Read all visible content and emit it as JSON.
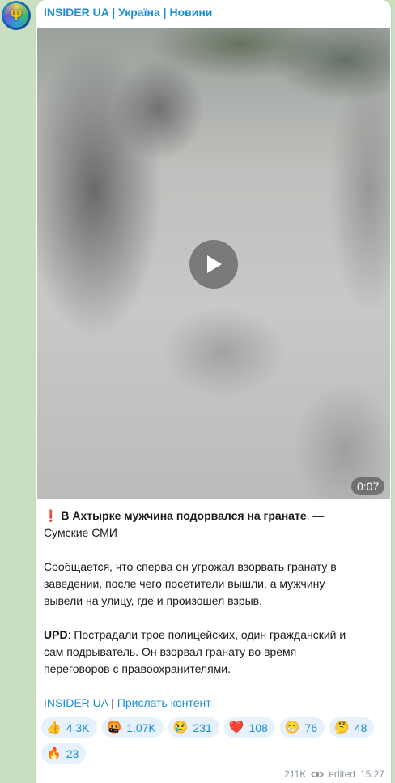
{
  "channel": {
    "name": "INSIDER UA | Україна | Новини",
    "avatar_icon": "trident-icon"
  },
  "post": {
    "video_duration": "0:07",
    "headline_mark": "❗️",
    "headline_bold": "В Ахтырке мужчина подорвался на гранате",
    "headline_rest": ", — Сумские СМИ",
    "paragraph1": "Сообщается, что сперва он угрожал взорвать гранату в заведении, после чего посетители вышли, а мужчину вывели на улицу, где и произошел взрыв.",
    "upd_label": "UPD",
    "upd_text": ": Пострадали трое полицейских, один гражданский и сам подрыватель. Он взорвал гранату во время переговоров с правоохранителями.",
    "link1": "INSIDER UA",
    "link_separator": " | ",
    "link2": "Прислать контент"
  },
  "reactions": [
    {
      "emoji": "👍",
      "count": "4.3K"
    },
    {
      "emoji": "🤬",
      "count": "1.07K"
    },
    {
      "emoji": "😢",
      "count": "231"
    },
    {
      "emoji": "❤️",
      "count": "108"
    },
    {
      "emoji": "😁",
      "count": "76"
    },
    {
      "emoji": "🤔",
      "count": "48"
    },
    {
      "emoji": "🔥",
      "count": "23"
    }
  ],
  "meta": {
    "views": "211K",
    "edited": "edited",
    "time": "15:27",
    "views_icon": "eye-icon"
  },
  "colors": {
    "accent": "#1c8fd4",
    "background": "#c9dfc0",
    "reaction_bg": "#e6f1fb"
  }
}
